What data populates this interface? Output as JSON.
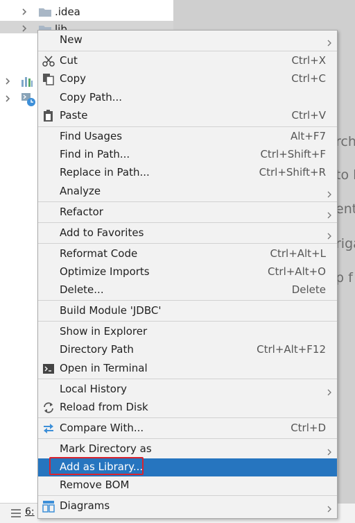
{
  "tree": {
    "items": [
      {
        "label": ".idea"
      },
      {
        "label": "lib"
      }
    ]
  },
  "editor": {
    "fragments": [
      "rch",
      "to l",
      "ent",
      "riga",
      "p f"
    ]
  },
  "statusbar": {
    "tab_label": "6:"
  },
  "menu": {
    "items": [
      {
        "label": "New",
        "shortcut": "",
        "submenu": true,
        "icon": ""
      },
      {
        "label": "Cut",
        "shortcut": "Ctrl+X",
        "icon": "scissors-icon"
      },
      {
        "label": "Copy",
        "shortcut": "Ctrl+C",
        "icon": "copy-icon"
      },
      {
        "label": "Copy Path...",
        "shortcut": ""
      },
      {
        "label": "Paste",
        "shortcut": "Ctrl+V",
        "icon": "clipboard-icon"
      },
      {
        "label": "Find Usages",
        "shortcut": "Alt+F7"
      },
      {
        "label": "Find in Path...",
        "shortcut": "Ctrl+Shift+F"
      },
      {
        "label": "Replace in Path...",
        "shortcut": "Ctrl+Shift+R"
      },
      {
        "label": "Analyze",
        "shortcut": "",
        "submenu": true
      },
      {
        "label": "Refactor",
        "shortcut": "",
        "submenu": true
      },
      {
        "label": "Add to Favorites",
        "shortcut": "",
        "submenu": true
      },
      {
        "label": "Reformat Code",
        "shortcut": "Ctrl+Alt+L"
      },
      {
        "label": "Optimize Imports",
        "shortcut": "Ctrl+Alt+O"
      },
      {
        "label": "Delete...",
        "shortcut": "Delete"
      },
      {
        "label": "Build Module 'JDBC'",
        "shortcut": ""
      },
      {
        "label": "Show in Explorer",
        "shortcut": ""
      },
      {
        "label": "Directory Path",
        "shortcut": "Ctrl+Alt+F12"
      },
      {
        "label": "Open in Terminal",
        "shortcut": "",
        "icon": "terminal-icon"
      },
      {
        "label": "Local History",
        "shortcut": "",
        "submenu": true
      },
      {
        "label": "Reload from Disk",
        "shortcut": "",
        "icon": "reload-icon"
      },
      {
        "label": "Compare With...",
        "shortcut": "Ctrl+D",
        "icon": "compare-icon"
      },
      {
        "label": "Mark Directory as",
        "shortcut": "",
        "submenu": true
      },
      {
        "label": "Add as Library...",
        "shortcut": "",
        "highlighted": true
      },
      {
        "label": "Remove BOM",
        "shortcut": ""
      },
      {
        "label": "Diagrams",
        "shortcut": "",
        "submenu": true,
        "icon": "diagram-icon"
      }
    ]
  },
  "colors": {
    "highlight": "#2675bf",
    "annotation_box": "#d9232e",
    "menu_bg": "#f2f2f2",
    "editor_bg": "#cfcfcf"
  }
}
